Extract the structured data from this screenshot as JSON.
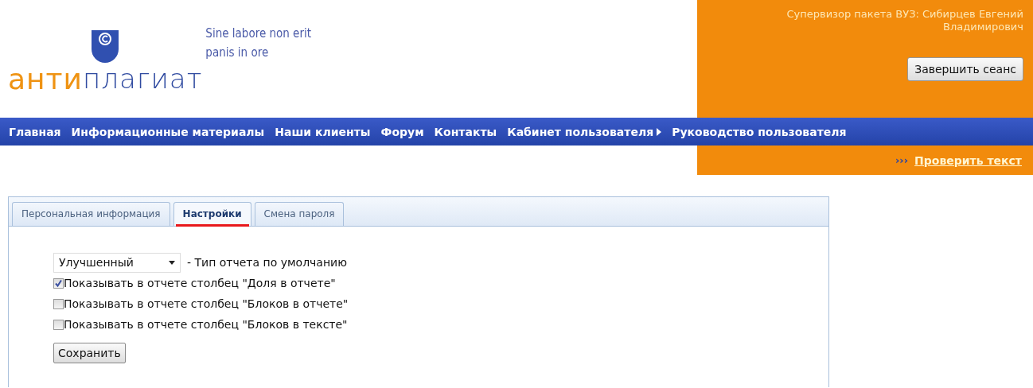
{
  "logo": {
    "part1": "анти",
    "part2": "плагиат",
    "motto_lines": [
      "Sine labore non erit",
      "panis in ore"
    ]
  },
  "user": {
    "role_line": "Супервизор пакета ВУЗ: Сибирцев Евгений Владимирович",
    "logout_button": "Завершить сеанс"
  },
  "nav": [
    {
      "label": "Главная",
      "has_arrow": false
    },
    {
      "label": "Информационные материалы",
      "has_arrow": false
    },
    {
      "label": "Наши клиенты",
      "has_arrow": false
    },
    {
      "label": "Форум",
      "has_arrow": false
    },
    {
      "label": "Контакты",
      "has_arrow": false
    },
    {
      "label": "Кабинет пользователя",
      "has_arrow": true
    },
    {
      "label": "Руководство пользователя",
      "has_arrow": false
    }
  ],
  "check_link": {
    "marker": "›››",
    "label": "Проверить текст"
  },
  "tabs": [
    {
      "label": "Персональная информация",
      "selected": false
    },
    {
      "label": "Настройки",
      "selected": true
    },
    {
      "label": "Смена пароля",
      "selected": false
    }
  ],
  "report_type": {
    "value": "Улучшенный",
    "label": "- Тип отчета по умолчанию"
  },
  "options": [
    {
      "label": "Показывать в отчете столбец \"Доля в отчете\"",
      "checked": true
    },
    {
      "label": "Показывать в отчете столбец \"Блоков в отчете\"",
      "checked": false
    },
    {
      "label": "Показывать в отчете столбец \"Блоков в тексте\"",
      "checked": false
    }
  ],
  "save_button": "Сохранить"
}
